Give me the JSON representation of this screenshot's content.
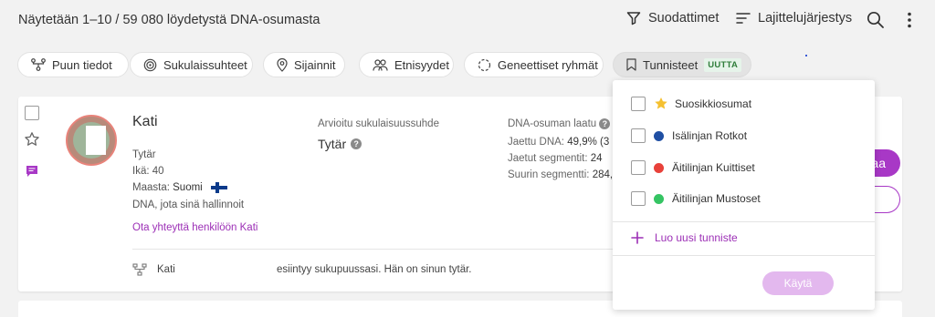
{
  "header": {
    "results": "Näytetään 1–10 / 59 080 löydetystä DNA-osumasta",
    "filters_label": "Suodattimet",
    "sort_label": "Lajittelujärjestys"
  },
  "chips": [
    {
      "label": "Puun tiedot"
    },
    {
      "label": "Sukulaissuhteet"
    },
    {
      "label": "Sijainnit"
    },
    {
      "label": "Etnisyydet"
    },
    {
      "label": "Geneettiset ryhmät"
    },
    {
      "label": "Tunnisteet",
      "badge": "UUTTA"
    }
  ],
  "match": {
    "name": "Kati",
    "relationship": "Tytär",
    "age": "Ikä: 40",
    "country_label": "Maasta:",
    "country": "Suomi",
    "managed": "DNA, jota sinä hallinnoit",
    "contact": "Ota yhteyttä henkilöön Kati",
    "estimated_label": "Arvioitu sukulaisuussuhde",
    "estimated_value": "Tytär",
    "quality_label": "DNA-osuman laatu",
    "shared_dna_label": "Jaettu DNA:",
    "shared_dna_value": "49,9% (3",
    "segments_label": "Jaetut segmentit:",
    "segments_value": "24",
    "largest_label": "Suurin segmentti:",
    "largest_value": "284,",
    "primary_button": "sumaa",
    "tree_name": "Kati",
    "tree_text": "esiintyy sukupuussasi. Hän on sinun tytär."
  },
  "dropdown": {
    "items": [
      {
        "label": "Suosikkiosumat",
        "icon": "star-icon",
        "color": "#f5c030"
      },
      {
        "label": "Isälinjan Rotkot",
        "color": "#1f4fa3"
      },
      {
        "label": "Äitilinjan Kuittiset",
        "color": "#e8413a"
      },
      {
        "label": "Äitilinjan Mustoset",
        "color": "#35c463"
      }
    ],
    "create_new": "Luo uusi tunniste",
    "apply": "Käytä"
  },
  "colors": {
    "accent": "#a838c6",
    "link": "#9c2fb6",
    "badge_bg": "#e6f4ea",
    "badge_fg": "#2f7d3a"
  }
}
